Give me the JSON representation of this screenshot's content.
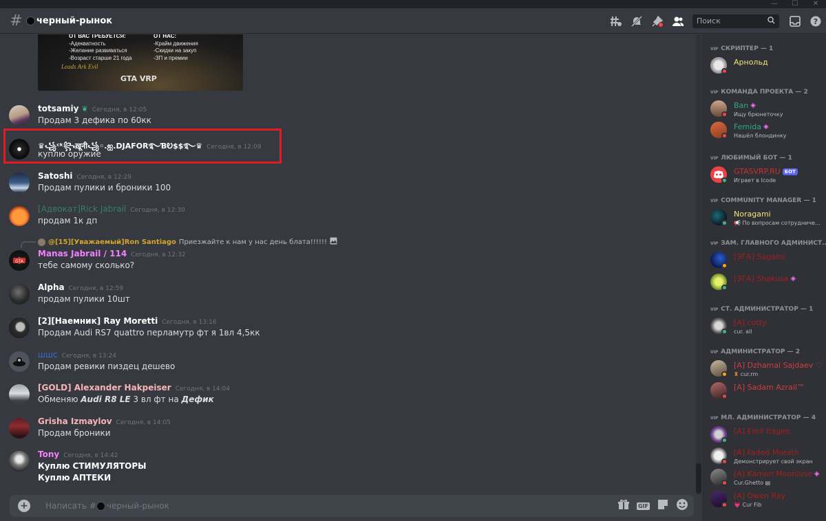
{
  "window": {
    "controls": [
      "—",
      "☐",
      "✕"
    ]
  },
  "header": {
    "channel": "черный-рынок",
    "search_placeholder": "Поиск"
  },
  "embed": {
    "left_head": "ОТ ВАС ТРЕБУЕТСЯ:",
    "left_lines": [
      "-Адекватность",
      "-Желание развиваться",
      "-Возраст старше 21 года"
    ],
    "right_head": "ОТ НАС:",
    "right_lines": [
      "-Крайм движения",
      "-Скидки на закуп",
      "-ЗП и премии"
    ],
    "signature": "Leads Ark Evil",
    "logo": "GTA VRP"
  },
  "messages": [
    {
      "author": "totsamiy",
      "color": "#ffffff",
      "time": "Сегодня, в 12:05",
      "text": "Продам 3 дефика по 60кк"
    },
    {
      "author": "♛꧁ᶜᵏ꧂ख़ूनी꧁◦.ஐ.DJAFOR࿐ƁᎧ$$࿐♛",
      "color": "#ffffff",
      "time": "Сегодня, в 12:09",
      "text": "куплю оружие"
    },
    {
      "author": "Satoshi",
      "color": "#ffffff",
      "time": "Сегодня, в 12:29",
      "text": "Продам пулики и броники 100"
    },
    {
      "author": "[Адвокат]Rick Jabrail",
      "color": "#3b7a6b",
      "time": "Сегодня, в 12:30",
      "text": "продам 1к дп"
    },
    {
      "author": "Manas Jabrail / 114",
      "color": "#f47fff",
      "time": "Сегодня, в 12:32",
      "text": "тебе самому сколько?",
      "reply_author": "@[15][Уважаемый]Ron Santiago",
      "reply_text": "Приезжайте к нам у нас день блата!!!!!!"
    },
    {
      "author": "Alpha",
      "color": "#ffffff",
      "time": "Сегодня, в 12:59",
      "text": "продам пулики 10шт"
    },
    {
      "author": "[2][Наемник] Ray Moretti",
      "color": "#ffffff",
      "time": "Сегодня, в 13:16",
      "text": "Продам Audi RS7 quattro перламутр фт я 1вл 4,5кк"
    },
    {
      "author": "шшс",
      "color": "#3b6bd6",
      "time": "Сегодня, в 13:24",
      "text": "Продам ревики пиздец дешево"
    },
    {
      "author": "[GOLD] Alexander Hakpeiser",
      "color": "#f8b5b5",
      "time": "Сегодня, в 14:04",
      "text_a": "Обменяю ",
      "text_b": "Audi R8 LE",
      "text_c": " 3 вл фт на ",
      "text_d": "Дефик"
    },
    {
      "author": "Grisha Izmaylov",
      "color": "#f8b5b5",
      "time": "Сегодня, в 14:05",
      "text": "Продам броники"
    },
    {
      "author": "Tony",
      "color": "#f47fff",
      "time": "Сегодня, в 14:42",
      "text": "Куплю СТИМУЛЯТОРЫ",
      "text2": "Куплю АПТЕКИ"
    }
  ],
  "composer": {
    "placeholder_a": "Написать #",
    "placeholder_b": "черный-рынок",
    "gif": "GIF"
  },
  "members": {
    "categories": [
      "СКРИПТЕР — 1",
      "КОМАНДА ПРОЕКТА — 2",
      "ЛЮБИМЫЙ БОТ — 1",
      "COMMUNITY MANAGER — 1",
      "ЗАМ. ГЛАВНОГО АДМИНИСТ...",
      "СТ. АДМИНИСТРАТОР — 1",
      "АДМИНИСТРАТОР — 2",
      "МЛ. АДМИНИСТРАТОР — 4"
    ],
    "vip": "VIP",
    "list": [
      {
        "name": "Арнольд",
        "color": "#f5e47a",
        "sub": ""
      },
      {
        "name": "Ban",
        "color": "#2fa88a",
        "sub": "Ищу брюнеточку"
      },
      {
        "name": "Femida",
        "color": "#2fa88a",
        "sub": "Нашёл блондинку"
      },
      {
        "name": "GTASVRP.RU",
        "color": "#c9302c",
        "sub": "Играет в Icode",
        "badge": "БОТ"
      },
      {
        "name": "Noragami",
        "color": "#f5e47a",
        "sub": "📢 По вопросам сотрудниче..."
      },
      {
        "name": "[ЗГА] Sagami",
        "color": "#a61e1e",
        "sub": ""
      },
      {
        "name": "[ЗГА] Shakusa",
        "color": "#a61e1e",
        "sub": ""
      },
      {
        "name": "[A] cotty",
        "color": "#a61e1e",
        "sub": "cur. all"
      },
      {
        "name": "[A] Dzhamal Sajdaev ♡",
        "color": "#d43c3c",
        "sub": "cur.rm"
      },
      {
        "name": "[A] Sadam Azrail™",
        "color": "#d43c3c",
        "sub": ""
      },
      {
        "name": "[A] Emil Itagen",
        "color": "#a61e1e",
        "sub": ""
      },
      {
        "name": "[A] Faded Morath",
        "color": "#a61e1e",
        "sub": "Демонстрирует свой экран"
      },
      {
        "name": "[A] Kamen Moonluse",
        "color": "#a61e1e",
        "sub": "Cur.Ghetto"
      },
      {
        "name": "[A] Owen Ray",
        "color": "#a61e1e",
        "sub": "💗 Cur Fib"
      }
    ]
  },
  "colors": {
    "highlight": "#e31b23",
    "bg": "#36393f",
    "sidebar": "#2f3136"
  }
}
